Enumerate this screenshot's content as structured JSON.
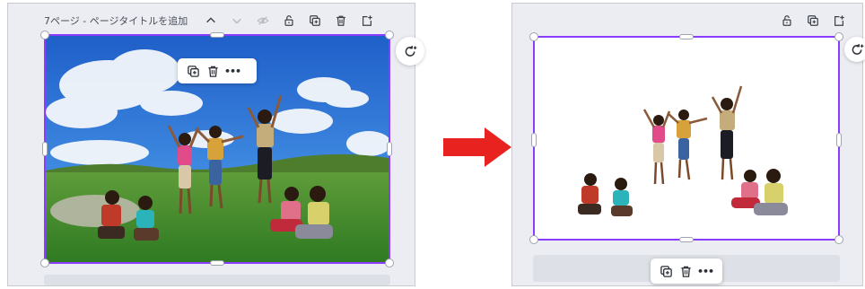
{
  "left_page": {
    "header_title": "7ページ - ページタイトルを追加",
    "icons": [
      "chevron-up-icon",
      "chevron-down-icon",
      "hide-icon",
      "lock-icon",
      "duplicate-icon",
      "trash-icon",
      "add-page-icon"
    ]
  },
  "right_page": {
    "icons": [
      "lock-icon",
      "duplicate-icon",
      "add-page-icon"
    ]
  },
  "element_toolbar": {
    "icons": [
      "duplicate-icon",
      "trash-icon",
      "more-icon"
    ],
    "more_label": "•••"
  },
  "colors": {
    "selection_border": "#8b3dff",
    "arrow": "#e8231f",
    "panel_background": "#ebedf2"
  }
}
